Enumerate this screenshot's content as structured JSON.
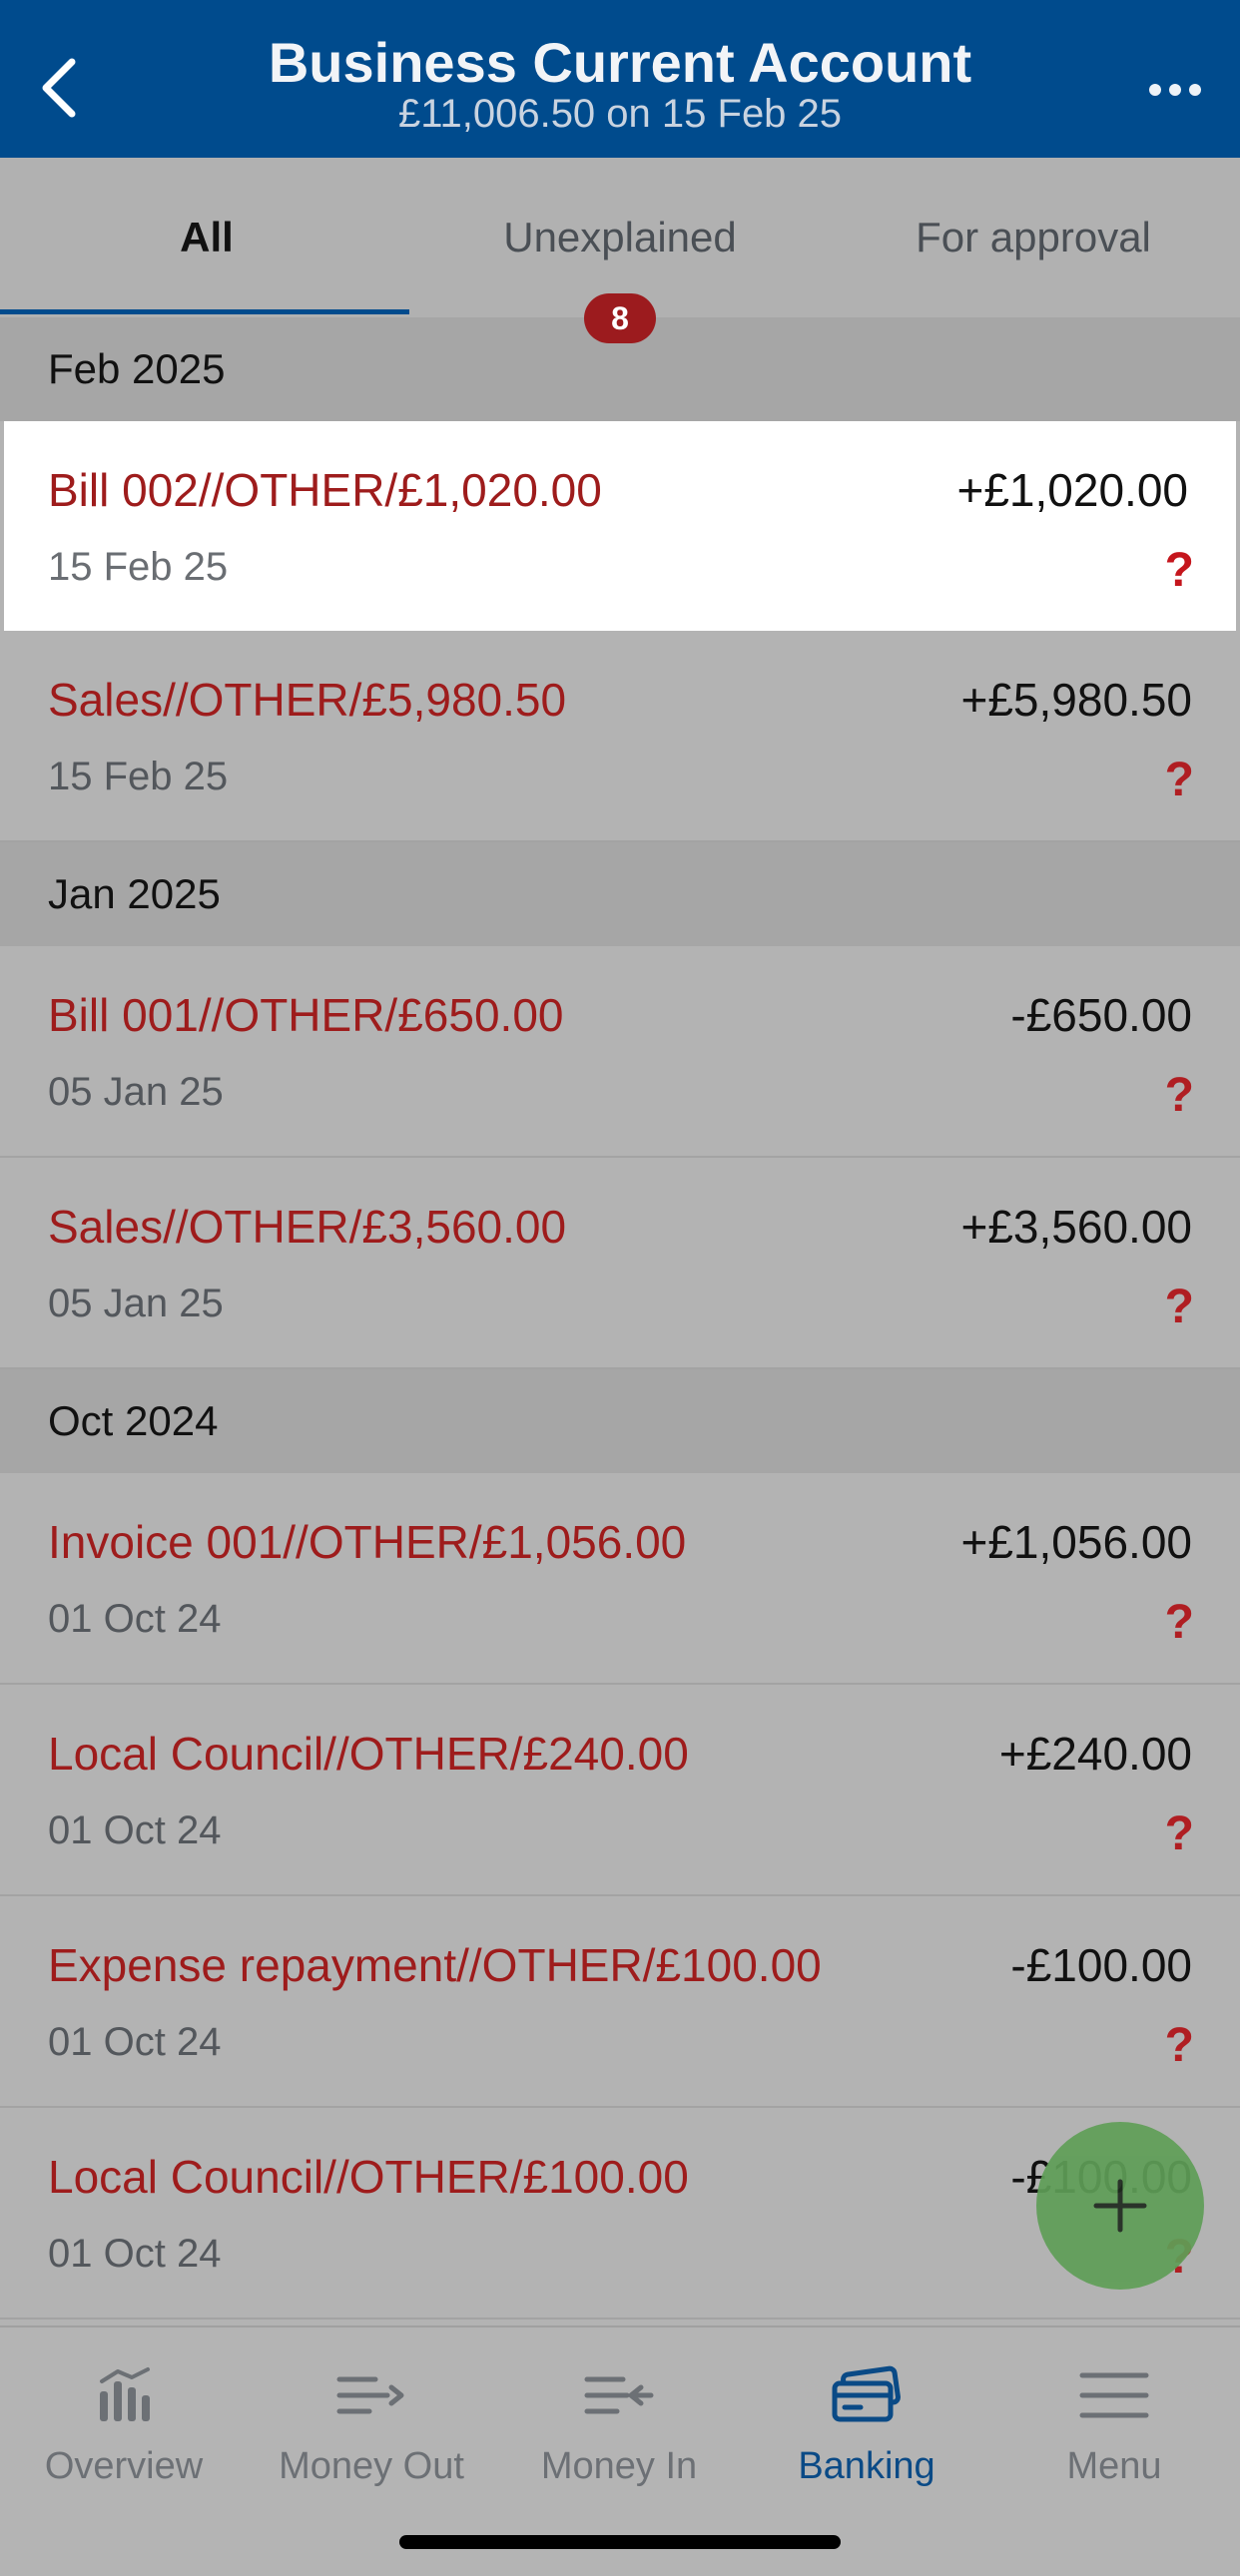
{
  "header": {
    "title": "Business Current Account",
    "subtitle": "£11,006.50 on 15 Feb 25"
  },
  "tabs": [
    {
      "label": "All",
      "active": true
    },
    {
      "label": "Unexplained",
      "badge": "8"
    },
    {
      "label": "For approval"
    }
  ],
  "months": {
    "feb": "Feb 2025",
    "jan": "Jan 2025",
    "oct": "Oct 2024"
  },
  "transactions": [
    {
      "title": "Bill 002//OTHER/£1,020.00",
      "amount": "+£1,020.00",
      "date": "15 Feb 25",
      "status": "?"
    },
    {
      "title": "Sales//OTHER/£5,980.50",
      "amount": "+£5,980.50",
      "date": "15 Feb 25",
      "status": "?"
    },
    {
      "title": "Bill 001//OTHER/£650.00",
      "amount": "-£650.00",
      "date": "05 Jan 25",
      "status": "?"
    },
    {
      "title": "Sales//OTHER/£3,560.00",
      "amount": "+£3,560.00",
      "date": "05 Jan 25",
      "status": "?"
    },
    {
      "title": "Invoice 001//OTHER/£1,056.00",
      "amount": "+£1,056.00",
      "date": "01 Oct 24",
      "status": "?"
    },
    {
      "title": "Local Council//OTHER/£240.00",
      "amount": "+£240.00",
      "date": "01 Oct 24",
      "status": "?"
    },
    {
      "title": "Expense repayment//OTHER/£100.00",
      "amount": "-£100.00",
      "date": "01 Oct 24",
      "status": "?"
    },
    {
      "title": "Local Council//OTHER/£100.00",
      "amount": "-£100.00",
      "date": "01 Oct 24",
      "status": "?"
    }
  ],
  "bottom_nav": [
    {
      "label": "Overview",
      "icon": "bar-chart-icon"
    },
    {
      "label": "Money Out",
      "icon": "money-out-icon"
    },
    {
      "label": "Money In",
      "icon": "money-in-icon"
    },
    {
      "label": "Banking",
      "icon": "bank-card-icon",
      "active": true
    },
    {
      "label": "Menu",
      "icon": "hamburger-icon"
    }
  ],
  "colors": {
    "header_bg": "#004b8d",
    "accent_red": "#9e1c1c",
    "badge_bg": "#9c1b1e",
    "fab_green": "#5f9e57",
    "active_nav": "#0a4a86"
  }
}
